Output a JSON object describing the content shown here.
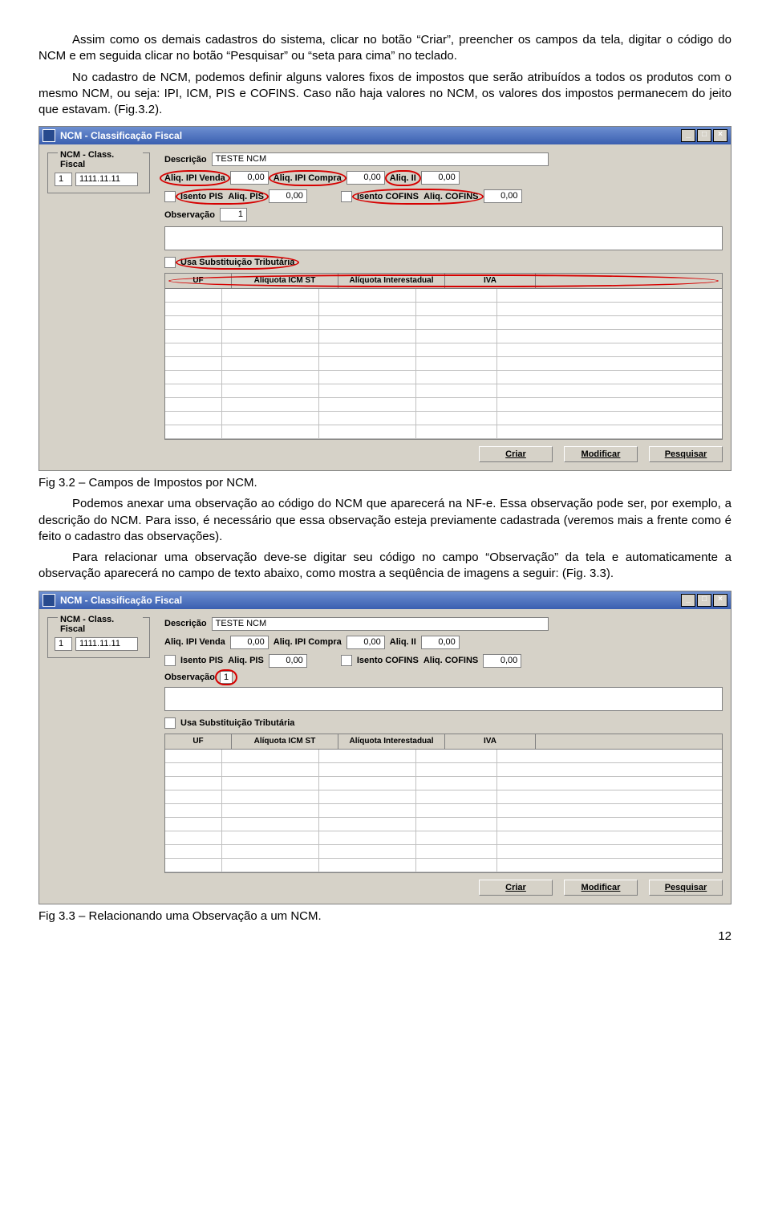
{
  "para1": "Assim como os demais cadastros do sistema, clicar no botão “Criar”, preencher os campos da tela, digitar o código do NCM e em seguida clicar no botão “Pesquisar” ou “seta para cima” no teclado.",
  "para2": "No cadastro de NCM, podemos definir alguns valores fixos de impostos que serão atribuídos a todos os produtos com o mesmo NCM, ou seja: IPI, ICM, PIS e COFINS. Caso não haja valores no NCM, os valores dos impostos permanecem do jeito que estavam. (Fig.3.2).",
  "fig32_caption": "Fig 3.2 – Campos de Impostos por NCM.",
  "para3": "Podemos anexar uma observação ao código do NCM que aparecerá na NF-e. Essa observação pode ser, por exemplo, a descrição do NCM. Para isso, é necessário que essa observação esteja previamente cadastrada (veremos mais a frente como é feito o cadastro das observações).",
  "para4": "Para relacionar uma observação deve-se digitar seu código no campo “Observação” da tela e automaticamente a observação aparecerá no campo de texto abaixo, como mostra a seqüência de imagens a seguir: (Fig. 3.3).",
  "fig33_caption": "Fig 3.3 – Relacionando uma Observação a um NCM.",
  "page_number": "12",
  "window": {
    "title": "NCM - Classificação Fiscal",
    "min": "_",
    "max": "□",
    "close": "×",
    "legend": "NCM - Class. Fiscal",
    "code1": "1",
    "code2": "1111.11.11",
    "labels": {
      "descricao": "Descrição",
      "aliq_ipi_venda": "Aliq. IPI Venda",
      "aliq_ipi_compra": "Aliq. IPI Compra",
      "aliq_ii": "Aliq. II",
      "isento_pis": "Isento PIS",
      "aliq_pis": "Aliq. PIS",
      "isento_cofins": "Isento COFINS",
      "aliq_cofins": "Aliq. COFINS",
      "observacao": "Observação",
      "usa_subst": "Usa Substituição Tributária"
    },
    "values": {
      "descricao": "TESTE NCM",
      "zz": "0,00",
      "observacao": "1"
    },
    "table": {
      "uf": "UF",
      "aliq_icm_st": "Alíquota ICM ST",
      "aliq_inter": "Alíquota Interestadual",
      "iva": "IVA"
    },
    "buttons": {
      "criar": "Criar",
      "modificar": "Modificar",
      "pesquisar": "Pesquisar"
    }
  }
}
